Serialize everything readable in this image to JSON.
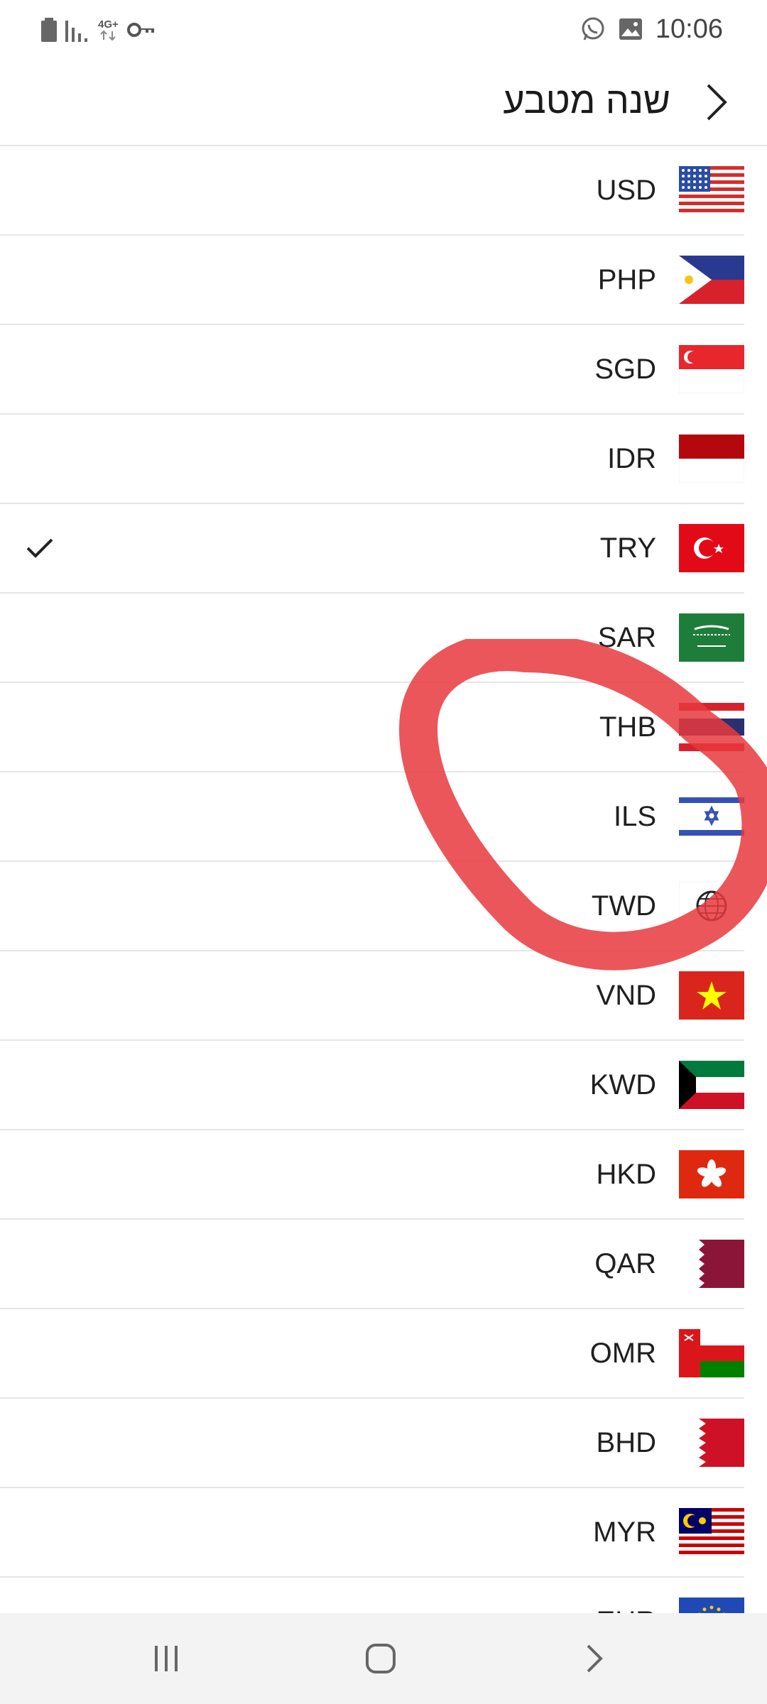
{
  "status_bar": {
    "time": "10:06",
    "network": "4G+"
  },
  "header": {
    "title": "שנה מטבע"
  },
  "currencies": [
    {
      "code": "USD",
      "flag": "us-flag-icon",
      "selected": false
    },
    {
      "code": "PHP",
      "flag": "ph-flag-icon",
      "selected": false
    },
    {
      "code": "SGD",
      "flag": "sg-flag-icon",
      "selected": false
    },
    {
      "code": "IDR",
      "flag": "id-flag-icon",
      "selected": false
    },
    {
      "code": "TRY",
      "flag": "tr-flag-icon",
      "selected": true
    },
    {
      "code": "SAR",
      "flag": "sa-flag-icon",
      "selected": false
    },
    {
      "code": "THB",
      "flag": "th-flag-icon",
      "selected": false
    },
    {
      "code": "ILS",
      "flag": "il-flag-icon",
      "selected": false
    },
    {
      "code": "TWD",
      "flag": "globe-flag-icon",
      "selected": false
    },
    {
      "code": "VND",
      "flag": "vn-flag-icon",
      "selected": false
    },
    {
      "code": "KWD",
      "flag": "kw-flag-icon",
      "selected": false
    },
    {
      "code": "HKD",
      "flag": "hk-flag-icon",
      "selected": false
    },
    {
      "code": "QAR",
      "flag": "qa-flag-icon",
      "selected": false
    },
    {
      "code": "OMR",
      "flag": "om-flag-icon",
      "selected": false
    },
    {
      "code": "BHD",
      "flag": "bh-flag-icon",
      "selected": false
    },
    {
      "code": "MYR",
      "flag": "my-flag-icon",
      "selected": false
    },
    {
      "code": "EUR",
      "flag": "eu-flag-icon",
      "selected": false
    }
  ],
  "colors": {
    "annotation": "#e8383d",
    "divider": "#e6e6e6",
    "navbar_bg": "#f3f3f3"
  }
}
